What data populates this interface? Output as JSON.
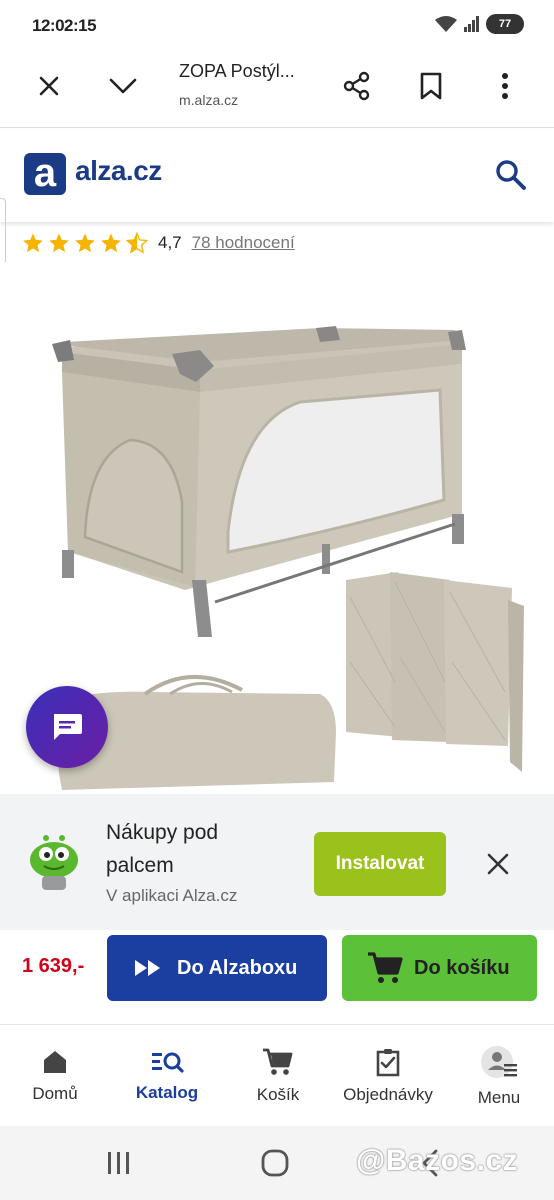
{
  "status_bar": {
    "time": "12:02:15",
    "battery": "77"
  },
  "browser": {
    "page_title": "ZOPA Postýl...",
    "url": "m.alza.cz",
    "icons": [
      "close-icon",
      "chevron-down-icon",
      "share-icon",
      "bookmark-icon",
      "more-vert-icon"
    ]
  },
  "site_header": {
    "logo_letter": "a",
    "logo_text": "alza.cz",
    "search_icon": "search-icon",
    "brand_color": "#1b3b84"
  },
  "rating": {
    "stars": 4.5,
    "value": "4,7",
    "count_link": "78 hodnocení",
    "star_color": "#f5b400"
  },
  "product": {
    "image_description_icon": "product-image"
  },
  "app_banner": {
    "title": "Nákupy pod palcem",
    "subtitle": "V aplikaci Alza.cz",
    "install_label": "Instalovat",
    "install_color": "#9bc21c"
  },
  "buy_bar": {
    "price": "1 639,-",
    "alzabox_label": "Do Alzaboxu",
    "cart_label": "Do košíku",
    "alzabox_color": "#1b3fa0",
    "cart_color": "#5cc139"
  },
  "bottom_nav": {
    "items": [
      {
        "label": "Domů",
        "icon": "home-icon"
      },
      {
        "label": "Katalog",
        "icon": "catalog-search-icon",
        "active": true
      },
      {
        "label": "Košík",
        "icon": "cart-icon"
      },
      {
        "label": "Objednávky",
        "icon": "orders-icon"
      },
      {
        "label": "Menu",
        "icon": "account-menu-icon"
      }
    ]
  },
  "system_nav": {
    "watermark": "@Bazos.cz"
  }
}
